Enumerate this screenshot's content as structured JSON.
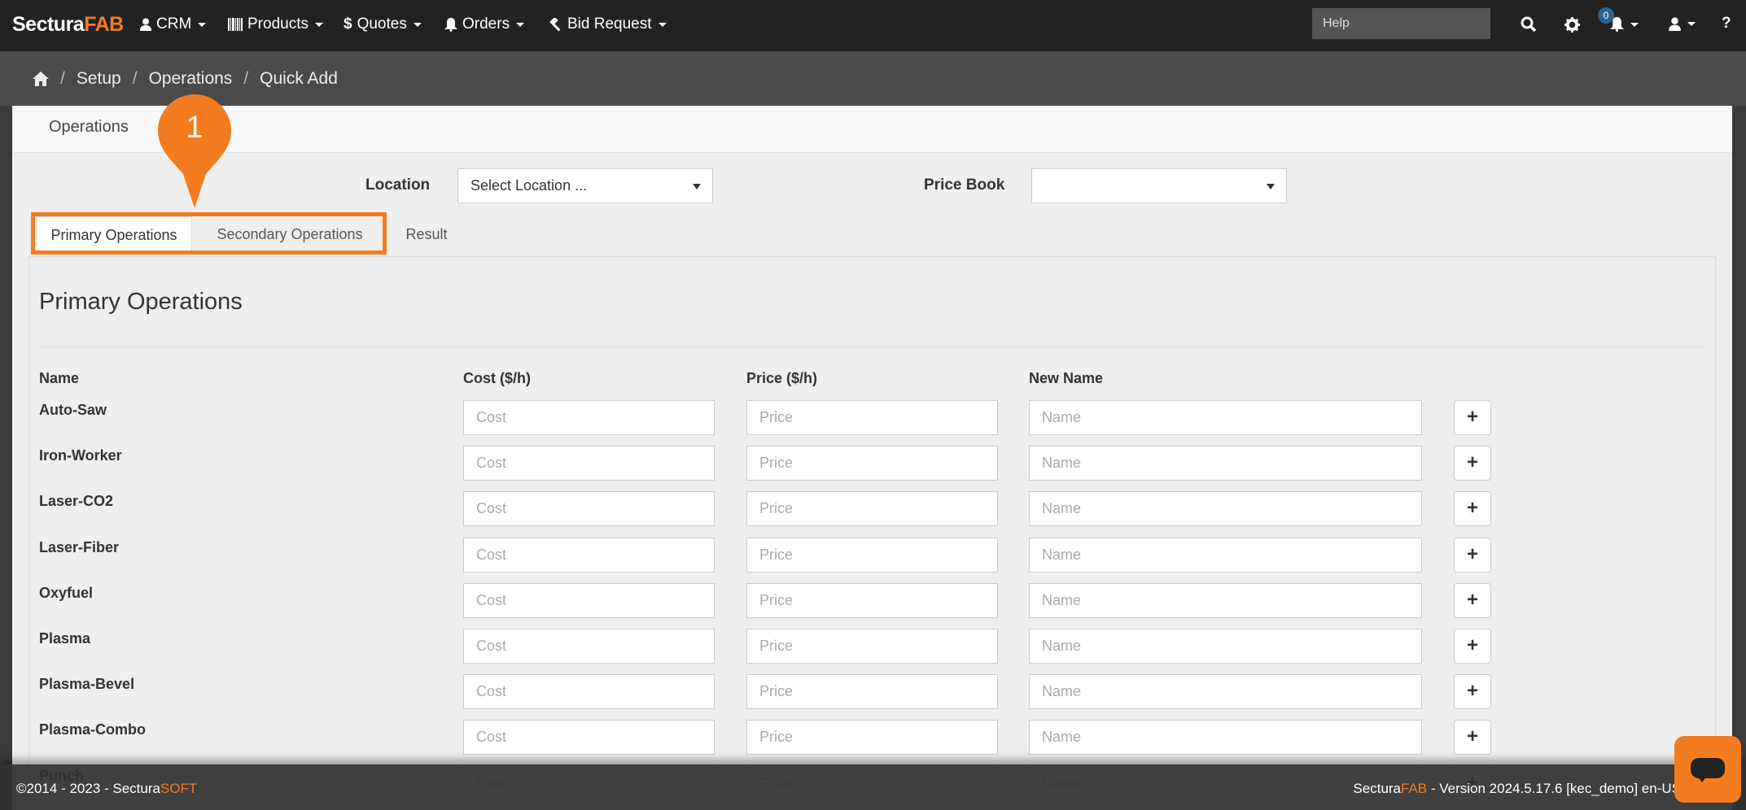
{
  "brand": {
    "prefix": "Sectura",
    "suffix": "FAB"
  },
  "nav": {
    "items": [
      {
        "label": "CRM",
        "icon": "user-icon"
      },
      {
        "label": "Products",
        "icon": "barcode-icon"
      },
      {
        "label": "Quotes",
        "icon": "dollar-icon"
      },
      {
        "label": "Orders",
        "icon": "bell-icon"
      },
      {
        "label": "Bid Request",
        "icon": "gavel-icon"
      }
    ],
    "help_placeholder": "Help",
    "notification_count": "0"
  },
  "breadcrumb": [
    "Setup",
    "Operations",
    "Quick Add"
  ],
  "panel": {
    "title": "Operations"
  },
  "filters": {
    "location_label": "Location",
    "location_value": "Select Location ...",
    "price_book_label": "Price Book",
    "price_book_value": ""
  },
  "tabs": [
    "Primary Operations",
    "Secondary Operations",
    "Result"
  ],
  "callout_number": "1",
  "section_title": "Primary Operations",
  "columns": {
    "name": "Name",
    "cost": "Cost ($/h)",
    "price": "Price ($/h)",
    "new_name": "New Name"
  },
  "placeholders": {
    "cost": "Cost",
    "price": "Price",
    "name": "Name"
  },
  "operations": [
    "Auto-Saw",
    "Iron-Worker",
    "Laser-CO2",
    "Laser-Fiber",
    "Oxyfuel",
    "Plasma",
    "Plasma-Bevel",
    "Plasma-Combo",
    "Punch"
  ],
  "add_label": "+",
  "footer": {
    "copyright": "©2014 - 2023 - Sectura",
    "copyright_suffix": "SOFT",
    "version_prefix": "Sectura",
    "version_brand": "FAB",
    "version_text": " - Version 2024.5.17.6 [kec_demo] en-US"
  },
  "colors": {
    "accent": "#f47c20",
    "navbar": "#222222"
  }
}
